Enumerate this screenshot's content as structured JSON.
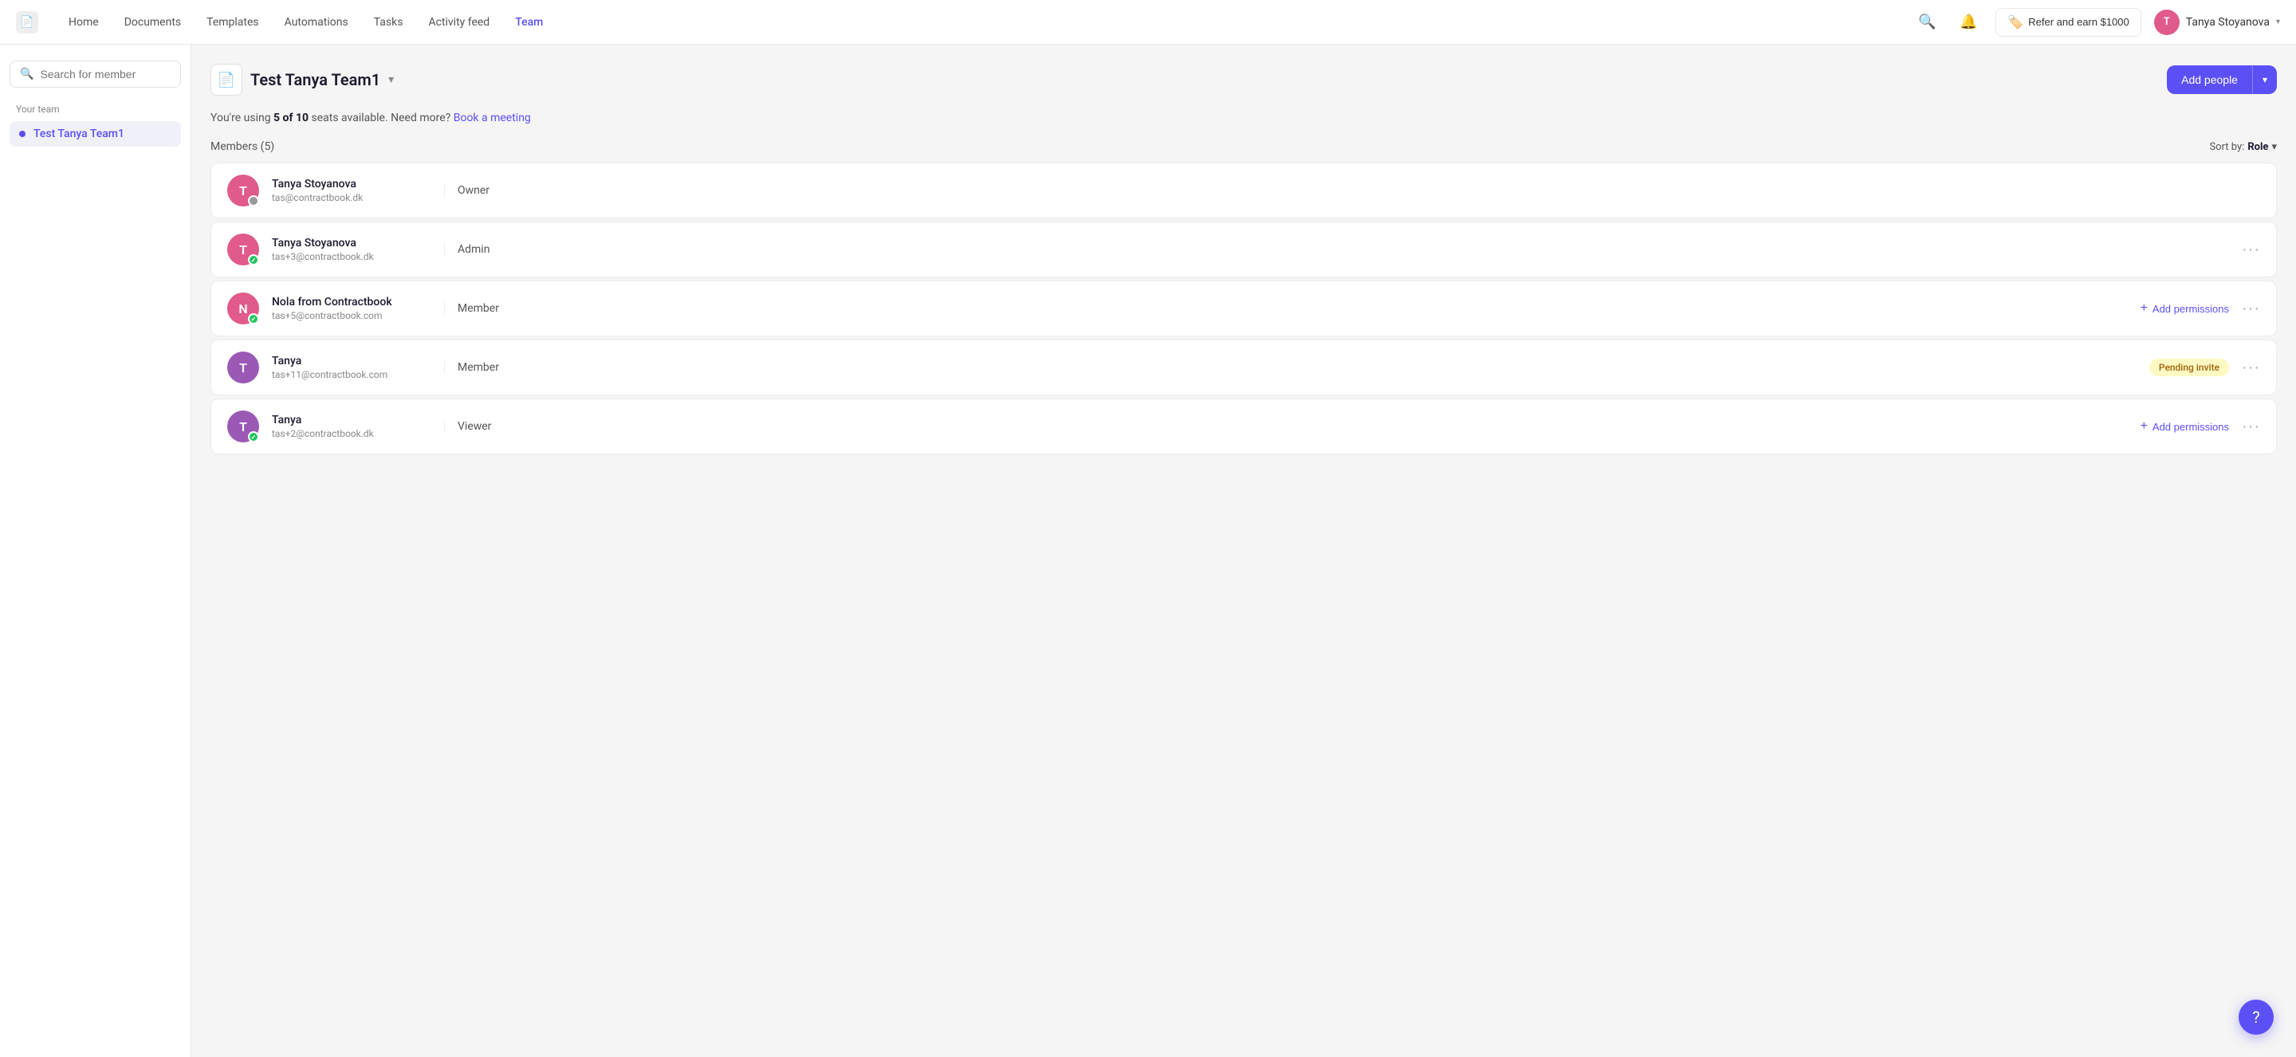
{
  "nav": {
    "logo_icon": "📄",
    "links": [
      {
        "label": "Home",
        "active": false
      },
      {
        "label": "Documents",
        "active": false
      },
      {
        "label": "Templates",
        "active": false
      },
      {
        "label": "Automations",
        "active": false
      },
      {
        "label": "Tasks",
        "active": false
      },
      {
        "label": "Activity feed",
        "active": false
      },
      {
        "label": "Team",
        "active": true
      }
    ],
    "search_icon": "🔍",
    "bell_icon": "🔔",
    "refer_label": "Refer and earn $1000",
    "refer_icon": "🏷️",
    "user": {
      "name": "Tanya Stoyanova",
      "initials": "T",
      "avatar_color": "#e05a8a"
    }
  },
  "sidebar": {
    "search_placeholder": "Search for member",
    "section_label": "Your team",
    "items": [
      {
        "label": "Test Tanya Team1",
        "active": true
      }
    ]
  },
  "main": {
    "team_icon": "📄",
    "team_title": "Test Tanya Team1",
    "add_people_label": "Add people",
    "seats_text_before": "You're using ",
    "seats_bold": "5 of 10",
    "seats_text_after": " seats available. Need more?",
    "book_meeting_label": "Book a meeting",
    "members_count_label": "Members (5)",
    "sort_by_label": "Sort by:",
    "sort_by_value": "Role",
    "members": [
      {
        "name": "Tanya Stoyanova",
        "email": "tas@contractbook.dk",
        "role": "Owner",
        "initials": "T",
        "avatar_color": "#e05a8a",
        "status": "gray",
        "has_add_perms": false,
        "has_pending": false,
        "has_more": false
      },
      {
        "name": "Tanya Stoyanova",
        "email": "tas+3@contractbook.dk",
        "role": "Admin",
        "initials": "T",
        "avatar_color": "#e05a8a",
        "status": "green",
        "has_add_perms": false,
        "has_pending": false,
        "has_more": true
      },
      {
        "name": "Nola from Contractbook",
        "email": "tas+5@contractbook.com",
        "role": "Member",
        "initials": "N",
        "avatar_color": "#e05a8a",
        "status": "green",
        "has_add_perms": true,
        "has_pending": false,
        "has_more": true,
        "avatar_color_override": "#e05a8a"
      },
      {
        "name": "Tanya",
        "email": "tas+11@contractbook.com",
        "role": "Member",
        "initials": "T",
        "avatar_color": "#9b59b6",
        "status": null,
        "has_add_perms": false,
        "has_pending": true,
        "has_more": true,
        "pending_label": "Pending invite"
      },
      {
        "name": "Tanya",
        "email": "tas+2@contractbook.dk",
        "role": "Viewer",
        "initials": "T",
        "avatar_color": "#9b59b6",
        "status": "green",
        "has_add_perms": true,
        "has_pending": false,
        "has_more": true
      }
    ],
    "add_permissions_label": "Add permissions"
  },
  "fab": {
    "icon": "?",
    "tooltip": "Help"
  }
}
